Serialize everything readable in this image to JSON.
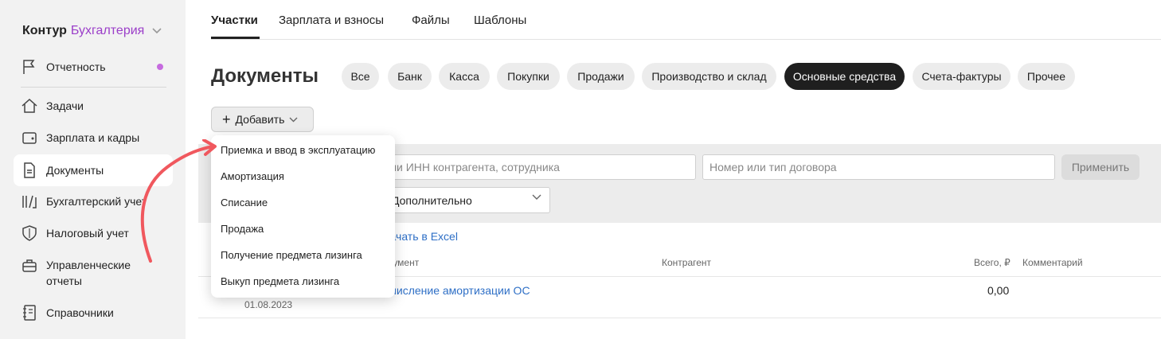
{
  "brand": {
    "name": "Контур",
    "product": "Бухгалтерия"
  },
  "sidebar": {
    "items": [
      {
        "label": "Отчетность"
      },
      {
        "label": "Задачи"
      },
      {
        "label": "Зарплата и кадры"
      },
      {
        "label": "Документы"
      },
      {
        "label": "Бухгалтерский учет"
      },
      {
        "label": "Налоговый учет"
      },
      {
        "label": "Управленческие отчеты"
      },
      {
        "label": "Справочники"
      }
    ]
  },
  "tabs": [
    "Участки",
    "Зарплата и взносы",
    "Файлы",
    "Шаблоны"
  ],
  "page_title": "Документы",
  "chips": [
    "Все",
    "Банк",
    "Касса",
    "Покупки",
    "Продажи",
    "Производство и склад",
    "Основные средства",
    "Счета-фактуры",
    "Прочее"
  ],
  "add_button": "Добавить",
  "filters": {
    "search_placeholder": "или ИНН контрагента, сотрудника",
    "contract_placeholder": "Номер или тип договора",
    "apply": "Применить",
    "more": "Дополнительно"
  },
  "excel_link": "Скачать в Excel",
  "table": {
    "headers": {
      "doc": "Документ",
      "counterparty": "Контрагент",
      "total": "Всего, ₽",
      "comment": "Комментарий"
    },
    "rows": [
      {
        "name": "Начисление амортизации ОС",
        "date": "01.08.2023",
        "total": "0,00"
      }
    ]
  },
  "menu": [
    "Приемка и ввод в эксплуатацию",
    "Амортизация",
    "Списание",
    "Продажа",
    "Получение предмета лизинга",
    "Выкуп предмета лизинга"
  ],
  "colors": {
    "accent": "#9b3ec9",
    "link": "#2e6fc6",
    "arrow": "#f0585e"
  }
}
